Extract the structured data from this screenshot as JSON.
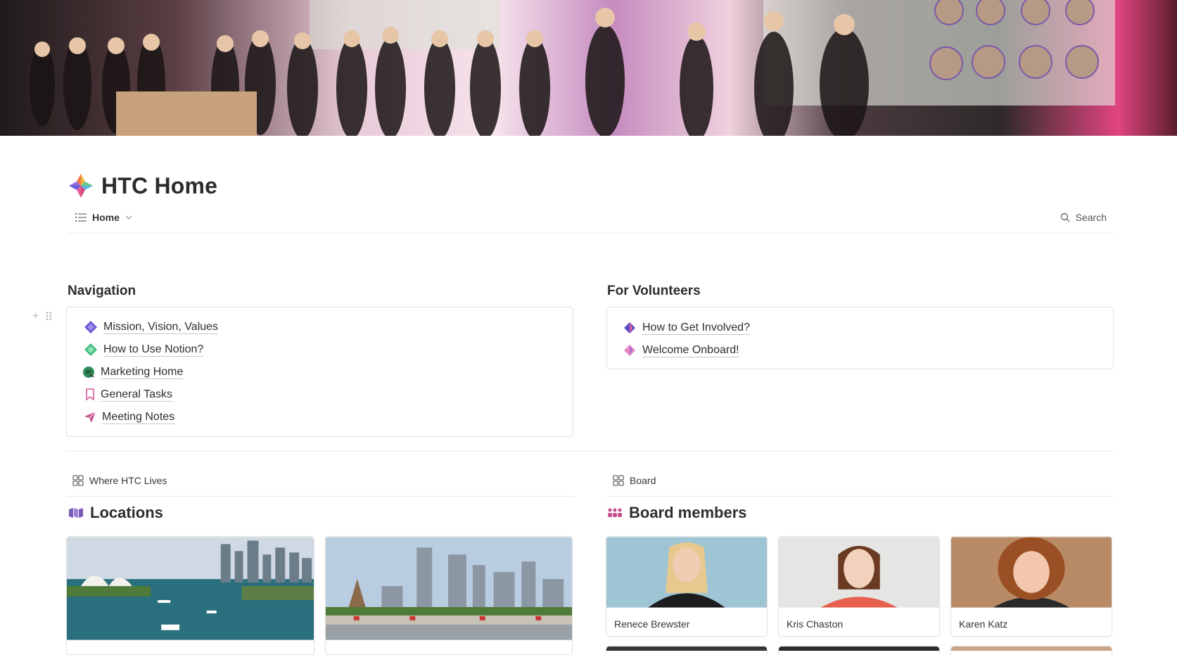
{
  "page": {
    "title": "HTC Home"
  },
  "view_bar": {
    "tab_label": "Home",
    "search_label": "Search"
  },
  "navigation": {
    "heading": "Navigation",
    "items": [
      {
        "label": "Mission, Vision, Values",
        "icon": "diamond-sparkle-icon"
      },
      {
        "label": "How to Use Notion?",
        "icon": "diamond-sparkle-icon"
      },
      {
        "label": "Marketing Home",
        "icon": "globe-icon"
      },
      {
        "label": "General Tasks",
        "icon": "bookmark-icon"
      },
      {
        "label": "Meeting Notes",
        "icon": "paper-plane-icon"
      }
    ]
  },
  "volunteers": {
    "heading": "For Volunteers",
    "items": [
      {
        "label": "How to Get Involved?",
        "icon": "diamond-sparkle-icon"
      },
      {
        "label": "Welcome Onboard!",
        "icon": "diamond-sparkle-icon"
      }
    ]
  },
  "locations": {
    "view_label": "Where HTC Lives",
    "title": "Locations",
    "icon": "map-icon",
    "cards": [
      {
        "name": "",
        "image": "sydney-harbour-photo"
      },
      {
        "name": "",
        "image": "melbourne-city-photo"
      }
    ]
  },
  "board": {
    "view_label": "Board",
    "title": "Board members",
    "icon": "people-icon",
    "cards": [
      {
        "name": "Renece Brewster",
        "image": "portrait-photo"
      },
      {
        "name": "Kris Chaston",
        "image": "portrait-photo"
      },
      {
        "name": "Karen Katz",
        "image": "portrait-photo"
      }
    ]
  },
  "colors": {
    "text": "#37352f",
    "accent_purple": "#6b5bd6",
    "accent_green": "#3fbf7f",
    "accent_pink": "#d65a9a"
  }
}
